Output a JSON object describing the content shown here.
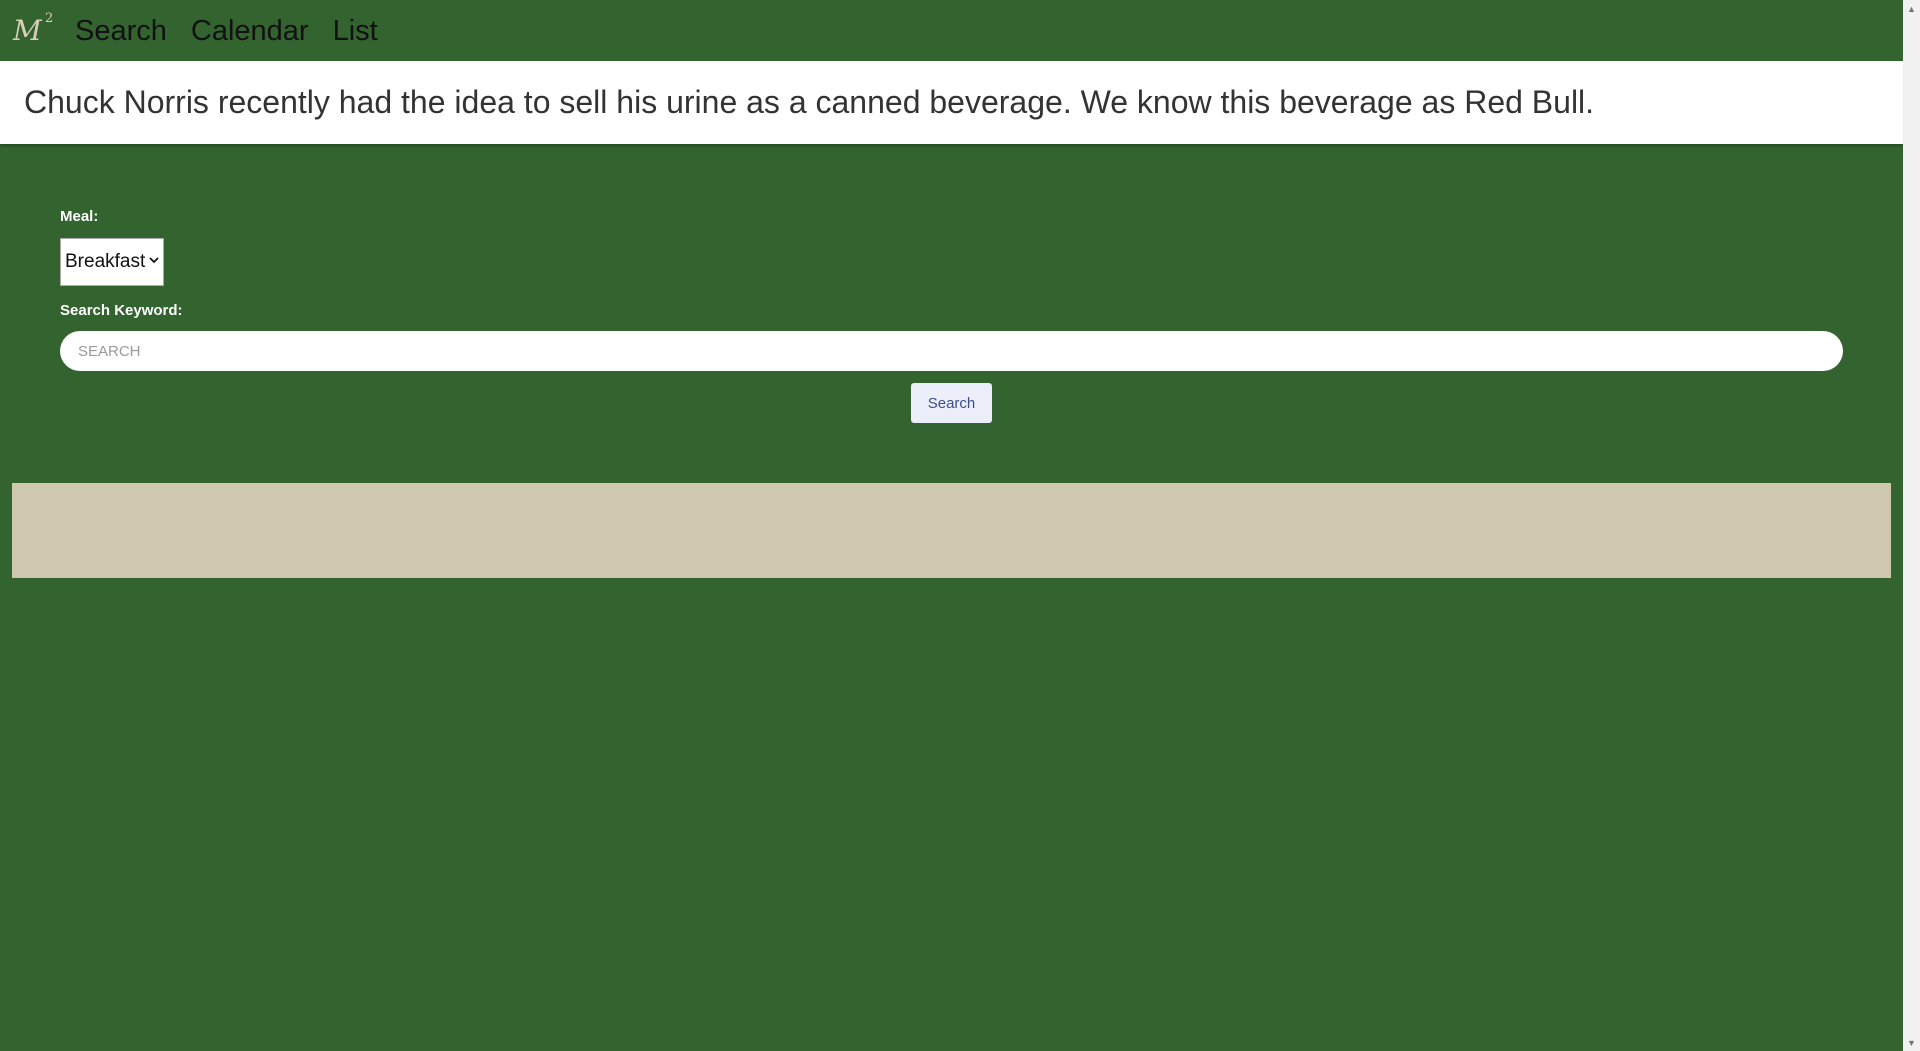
{
  "navbar": {
    "logo_text": "M",
    "logo_superscript": "2",
    "links": [
      "Search",
      "Calendar",
      "List"
    ]
  },
  "banner": {
    "quote": "Chuck Norris recently had the idea to sell his urine as a canned beverage. We know this beverage as Red Bull."
  },
  "form": {
    "meal_label": "Meal:",
    "meal_selected": "Breakfast",
    "keyword_label": "Search Keyword:",
    "search_placeholder": "SEARCH",
    "search_button": "Search"
  },
  "colors": {
    "background": "#33632f",
    "results_panel": "#cfc7b0",
    "button_bg": "#eceff9"
  }
}
